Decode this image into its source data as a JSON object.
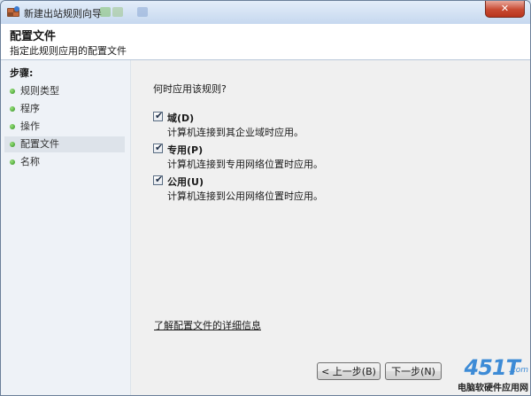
{
  "window": {
    "title": "新建出站规则向导",
    "close_glyph": "✕"
  },
  "header": {
    "title": "配置文件",
    "subtitle": "指定此规则应用的配置文件"
  },
  "steps": {
    "label": "步骤:",
    "items": [
      {
        "label": "规则类型"
      },
      {
        "label": "程序"
      },
      {
        "label": "操作"
      },
      {
        "label": "配置文件",
        "active": true
      },
      {
        "label": "名称"
      }
    ]
  },
  "content": {
    "question": "何时应用该规则?",
    "options": [
      {
        "label": "域(D)",
        "desc": "计算机连接到其企业域时应用。",
        "checked": true
      },
      {
        "label": "专用(P)",
        "desc": "计算机连接到专用网络位置时应用。",
        "checked": true
      },
      {
        "label": "公用(U)",
        "desc": "计算机连接到公用网络位置时应用。",
        "checked": true
      }
    ],
    "learn_more": "了解配置文件的详细信息"
  },
  "buttons": {
    "back": "< 上一步(B)",
    "next": "下一步(N)"
  },
  "watermark": {
    "logo": "451T",
    "domain": ".com",
    "sub": "电脑软硬件应用网"
  },
  "colors": {
    "step_dot": "#2f8e20",
    "watermark_blue": "#3d8bd6"
  },
  "icons": {
    "check": "✔"
  }
}
